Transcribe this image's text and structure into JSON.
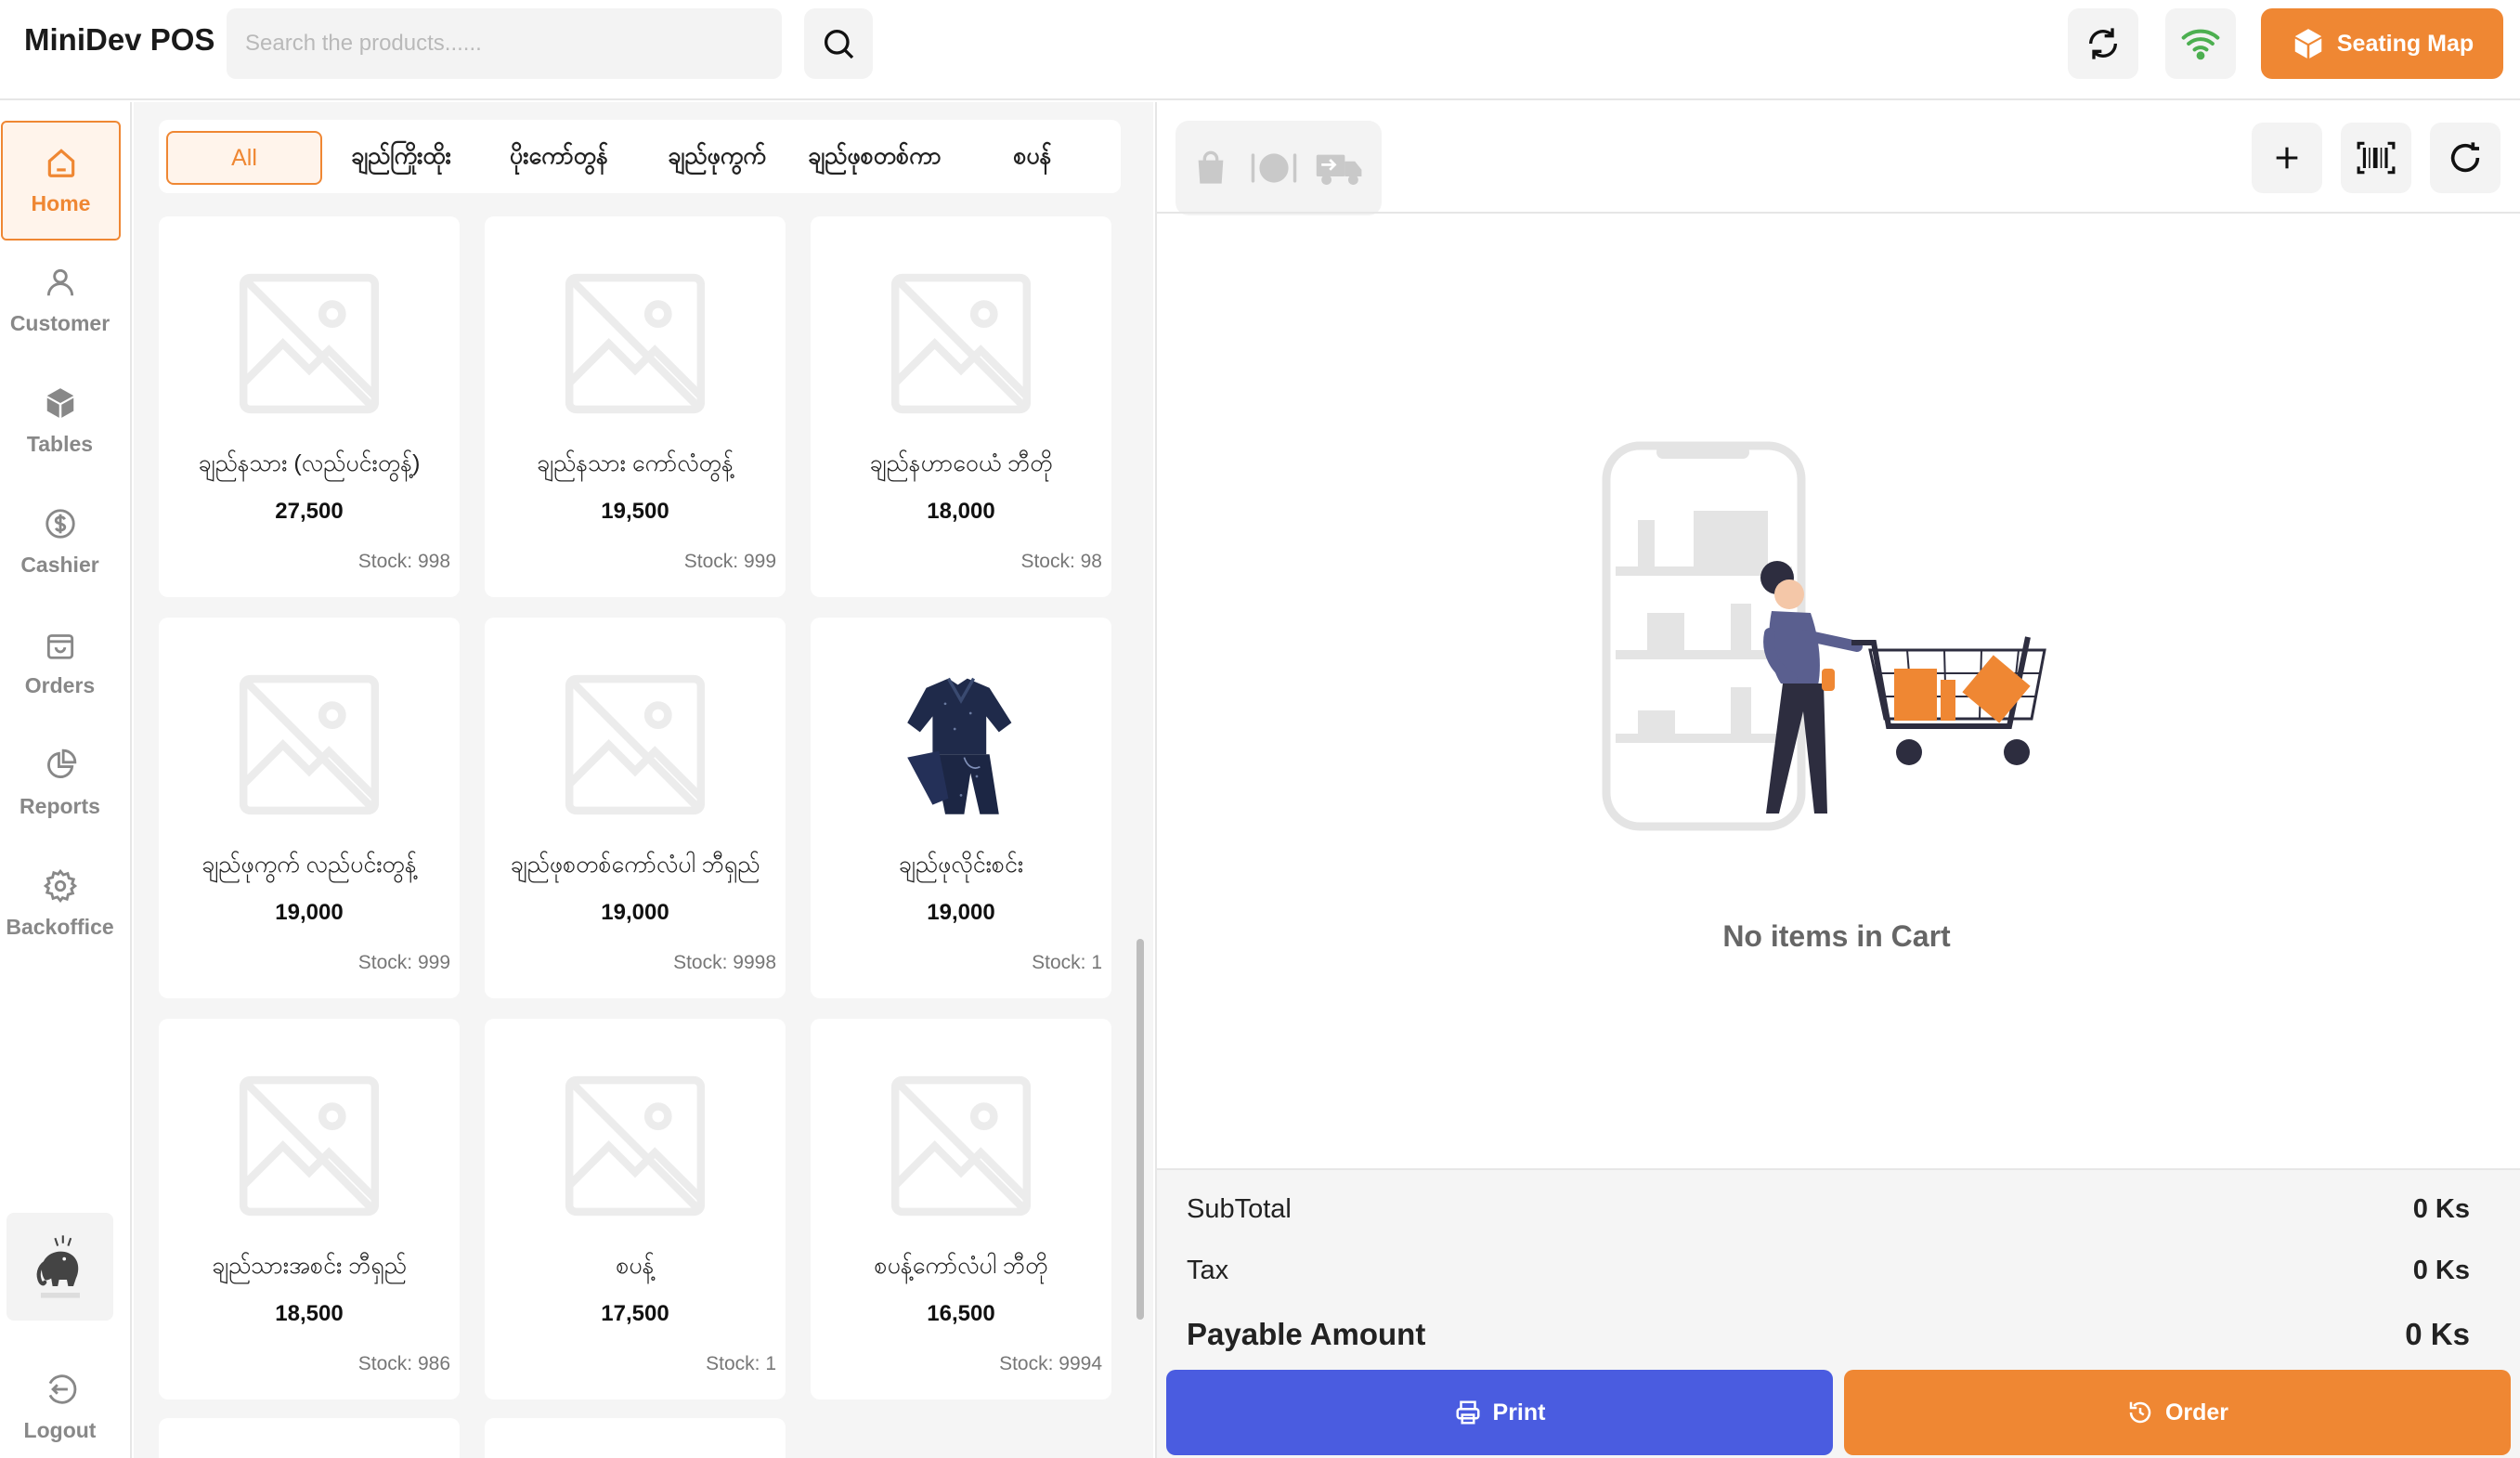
{
  "header": {
    "app_title": "MiniDev POS",
    "search_placeholder": "Search the products......",
    "seating_map_label": "Seating Map"
  },
  "sidebar": {
    "items": [
      {
        "label": "Home",
        "icon": "home-icon",
        "active": true
      },
      {
        "label": "Customer",
        "icon": "user-icon"
      },
      {
        "label": "Tables",
        "icon": "cube-icon"
      },
      {
        "label": "Cashier",
        "icon": "dollar-icon"
      },
      {
        "label": "Orders",
        "icon": "bag-icon"
      },
      {
        "label": "Reports",
        "icon": "pie-chart-icon"
      },
      {
        "label": "Backoffice",
        "icon": "gear-icon"
      }
    ],
    "logout_label": "Logout"
  },
  "categories": [
    "All",
    "ချည်ကြိုးထိုး",
    "ပိုးကော်တွန်",
    "ချည်ဖုကွက်",
    "ချည်ဖုစတစ်ကာ",
    "စပန်"
  ],
  "products": [
    {
      "name": "ချည်နသား (လည်ပင်းတွန့်)",
      "price": "27,500",
      "stock": "Stock: 998"
    },
    {
      "name": "ချည်နသား ကော်လံတွန့်",
      "price": "19,500",
      "stock": "Stock: 999"
    },
    {
      "name": "ချည်နဟာဝေယံ ဘီတို",
      "price": "18,000",
      "stock": "Stock: 98"
    },
    {
      "name": "ချည်ဖုကွက် လည်ပင်းတွန့်",
      "price": "19,000",
      "stock": "Stock: 999"
    },
    {
      "name": "ချည်ဖုစတစ်ကော်လံပါ ဘီရှည်",
      "price": "19,000",
      "stock": "Stock: 9998"
    },
    {
      "name": "ချည်ဖုလိုင်းစင်း",
      "price": "19,000",
      "stock": "Stock: 1",
      "has_photo": true
    },
    {
      "name": "ချည်သားအစင်း ဘီရှည်",
      "price": "18,500",
      "stock": "Stock: 986"
    },
    {
      "name": "စပန့်",
      "price": "17,500",
      "stock": "Stock: 1"
    },
    {
      "name": "စပန့်ကော်လံပါ ဘီတို",
      "price": "16,500",
      "stock": "Stock: 9994"
    }
  ],
  "cart": {
    "empty_text": "No items in Cart",
    "subtotal_label": "SubTotal",
    "subtotal_value": "0 Ks",
    "tax_label": "Tax",
    "tax_value": "0 Ks",
    "payable_label": "Payable Amount",
    "payable_value": "0 Ks",
    "print_label": "Print",
    "order_label": "Order"
  },
  "colors": {
    "accent": "#ef8733",
    "primary_blue": "#4a5ce0",
    "wifi_green": "#4caf50"
  }
}
